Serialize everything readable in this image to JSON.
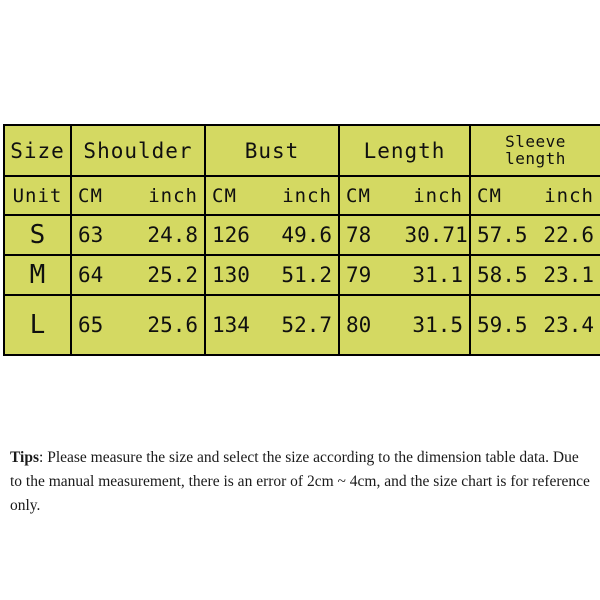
{
  "table": {
    "size_header": "Size",
    "unit_header": "Unit",
    "unit_cm": "CM",
    "unit_inch": "inch",
    "groups": [
      {
        "label": "Shoulder",
        "wrap": false
      },
      {
        "label": "Bust",
        "wrap": false
      },
      {
        "label": "Length",
        "wrap": false
      },
      {
        "label": "Sleeve",
        "label2": "length",
        "wrap": true
      }
    ],
    "rows": [
      {
        "size": "S",
        "shoulder_cm": "63",
        "shoulder_inch": "24.8",
        "bust_cm": "126",
        "bust_inch": "49.6",
        "length_cm": "78",
        "length_inch": "30.71",
        "sleeve_cm": "57.5",
        "sleeve_inch": "22.6"
      },
      {
        "size": "M",
        "shoulder_cm": "64",
        "shoulder_inch": "25.2",
        "bust_cm": "130",
        "bust_inch": "51.2",
        "length_cm": "79",
        "length_inch": "31.1",
        "sleeve_cm": "58.5",
        "sleeve_inch": "23.1"
      },
      {
        "size": "L",
        "shoulder_cm": "65",
        "shoulder_inch": "25.6",
        "bust_cm": "134",
        "bust_inch": "52.7",
        "length_cm": "80",
        "length_inch": "31.5",
        "sleeve_cm": "59.5",
        "sleeve_inch": "23.4"
      }
    ],
    "colors": {
      "cell_background": "#d4d962",
      "border": "#000000",
      "text": "#101010"
    }
  },
  "tips": {
    "label": "Tips",
    "body": ": Please measure the size and select the size according to the dimension table data. Due to the manual measurement, there is an error of 2cm ~ 4cm, and the size chart is for reference only."
  }
}
